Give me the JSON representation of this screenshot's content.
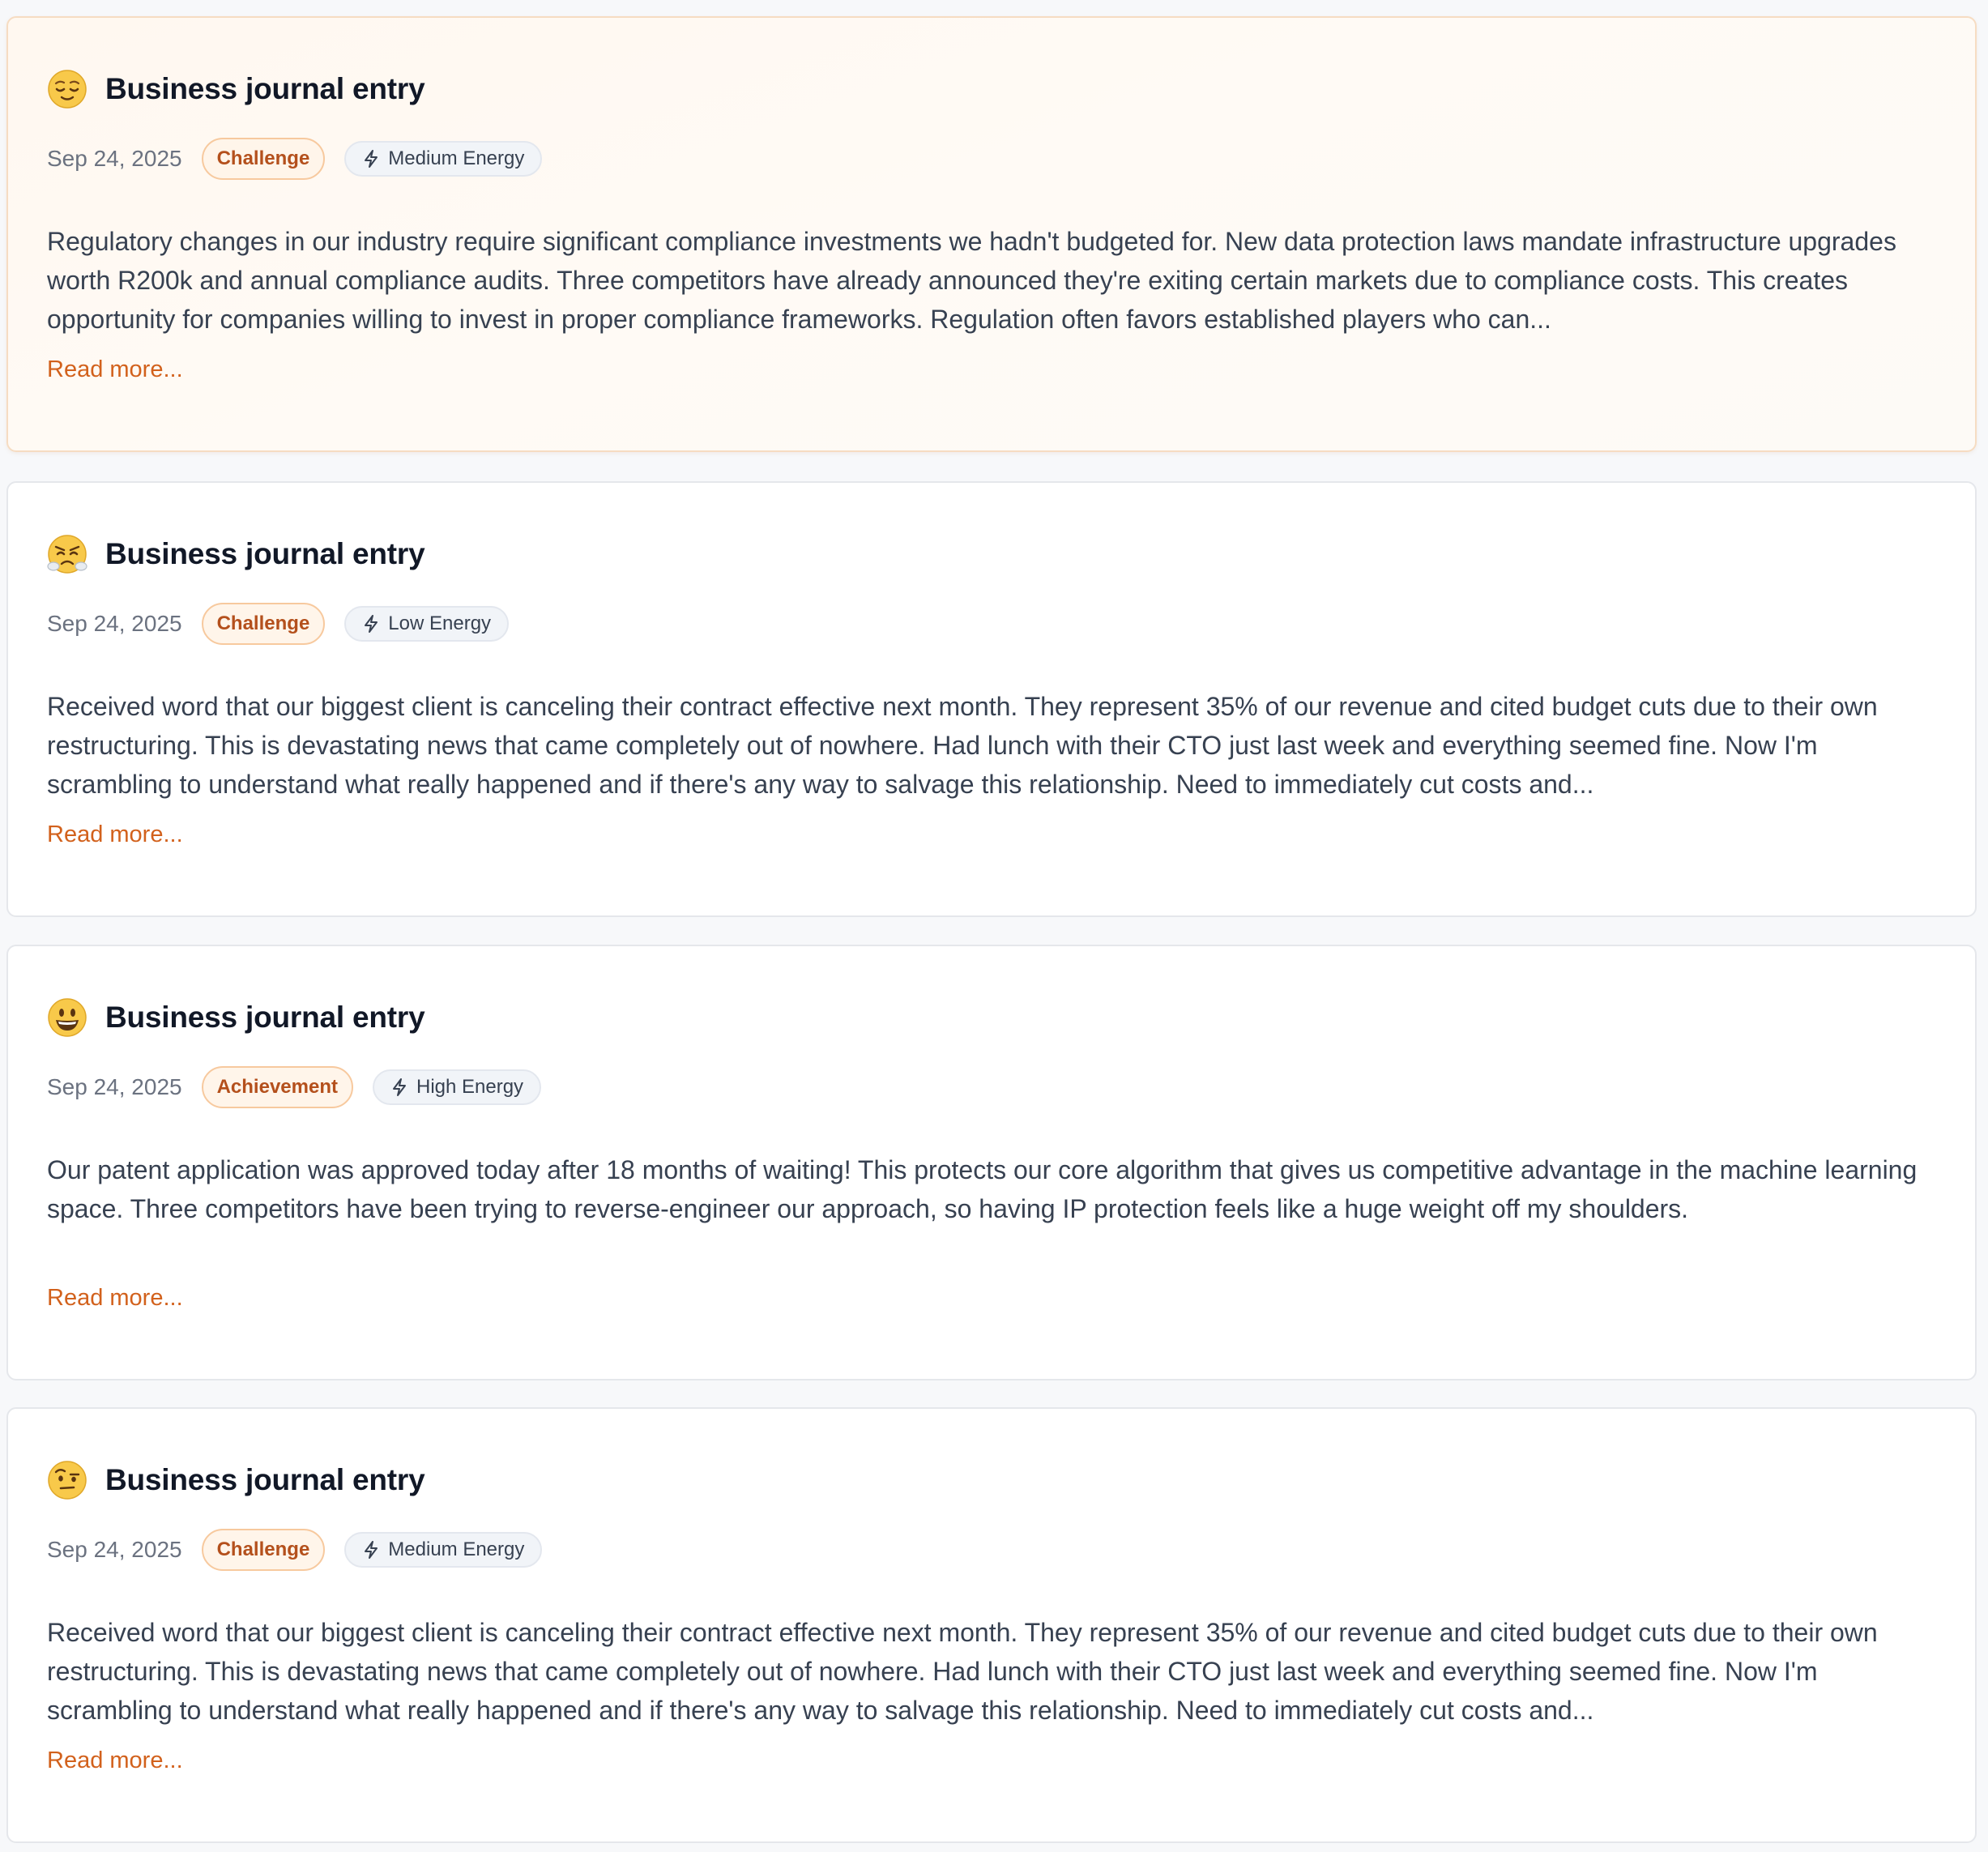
{
  "accent_color": "#d2611c",
  "entries": [
    {
      "mood_icon": "relieved-face-icon",
      "title": "Business journal entry",
      "date": "Sep 24, 2025",
      "category": "Challenge",
      "energy": "Medium Energy",
      "body": "Regulatory changes in our industry require significant compliance investments we hadn't budgeted for. New data protection laws mandate infrastructure upgrades worth R200k and annual compliance audits. Three competitors have already announced they're exiting certain markets due to compliance costs. This creates opportunity for companies willing to invest in proper compliance frameworks. Regulation often favors established players who can...",
      "read_more": "Read more..."
    },
    {
      "mood_icon": "face-with-steam-icon",
      "title": "Business journal entry",
      "date": "Sep 24, 2025",
      "category": "Challenge",
      "energy": "Low Energy",
      "body": "Received word that our biggest client is canceling their contract effective next month. They represent 35% of our revenue and cited budget cuts due to their own restructuring. This is devastating news that came completely out of nowhere. Had lunch with their CTO just last week and everything seemed fine. Now I'm scrambling to understand what really happened and if there's any way to salvage this relationship. Need to immediately cut costs and...",
      "read_more": "Read more..."
    },
    {
      "mood_icon": "grinning-face-icon",
      "title": "Business journal entry",
      "date": "Sep 24, 2025",
      "category": "Achievement",
      "energy": "High Energy",
      "body": "Our patent application was approved today after 18 months of waiting! This protects our core algorithm that gives us competitive advantage in the machine learning space. Three competitors have been trying to reverse-engineer our approach, so having IP protection feels like a huge weight off my shoulders.",
      "read_more": "Read more..."
    },
    {
      "mood_icon": "face-with-raised-eyebrow-icon",
      "title": "Business journal entry",
      "date": "Sep 24, 2025",
      "category": "Challenge",
      "energy": "Medium Energy",
      "body": "Received word that our biggest client is canceling their contract effective next month. They represent 35% of our revenue and cited budget cuts due to their own restructuring. This is devastating news that came completely out of nowhere. Had lunch with their CTO just last week and everything seemed fine. Now I'm scrambling to understand what really happened and if there's any way to salvage this relationship. Need to immediately cut costs and...",
      "read_more": "Read more..."
    }
  ]
}
